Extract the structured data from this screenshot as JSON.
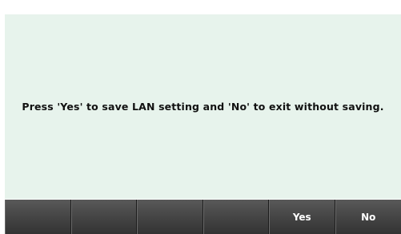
{
  "dialog": {
    "message": "Press 'Yes' to save LAN setting and 'No' to exit without saving."
  },
  "softkeys": [
    {
      "label": ""
    },
    {
      "label": ""
    },
    {
      "label": ""
    },
    {
      "label": ""
    },
    {
      "label": "Yes"
    },
    {
      "label": "No"
    }
  ],
  "colors": {
    "dialog_background": "#e7f3ec",
    "softkey_background": "#474747",
    "softkey_text": "#ffffff",
    "message_text": "#111111"
  }
}
